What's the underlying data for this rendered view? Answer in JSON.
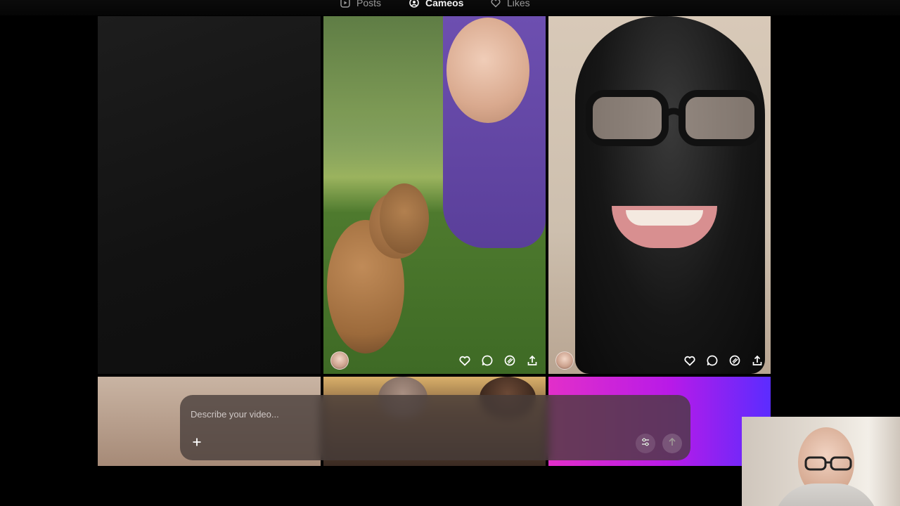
{
  "tabs": [
    {
      "label": "Posts",
      "icon": "play-square-icon",
      "active": false
    },
    {
      "label": "Cameos",
      "icon": "face-circle-icon",
      "active": true
    },
    {
      "label": "Likes",
      "icon": "heart-icon",
      "active": false
    }
  ],
  "composer": {
    "placeholder": "Describe your video..."
  },
  "post_actions": [
    "heart-icon",
    "comment-icon",
    "remix-icon",
    "share-icon"
  ],
  "colors": {
    "background": "#000000",
    "composer_bg": "#463a3a"
  }
}
